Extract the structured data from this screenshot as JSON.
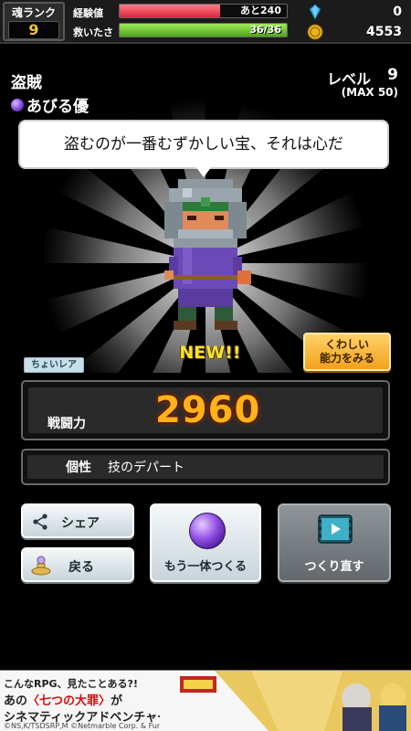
{
  "topbar": {
    "soul_rank_label": "魂ランク",
    "soul_rank_value": "9",
    "exp_label": "経験値",
    "exp_remaining": "あと240",
    "exp_fill_fraction": 0.6,
    "rescue_label": "救いたさ",
    "rescue_value": "36/36",
    "rescue_fill_fraction": 1.0,
    "gems": "0",
    "coins": "4553"
  },
  "character": {
    "class_name": "盗賊",
    "creator": "あびる優",
    "level_label": "レベル",
    "level": "9",
    "level_max": "(MAX 50)",
    "quote": "盗むのが一番むずかしい宝、それは心だ",
    "new_label": "NEW!!",
    "rarity": "ちょいレア",
    "power_label": "戦闘力",
    "power": "2960",
    "trait_label": "個性",
    "trait": "技のデパート"
  },
  "buttons": {
    "detail_line1": "くわしい",
    "detail_line2": "能力をみる",
    "share": "シェア",
    "back": "戻る",
    "make_another": "もう一体つくる",
    "remake": "つくり直す"
  },
  "banner": {
    "line1": "こんなRPG、見たことある?!",
    "line2_prefix": "あの",
    "line2_title": "〈七つの大罪〉",
    "line2_suffix": "が",
    "line3": "シネマティックアドベンチャーRPGで登場!",
    "copyright": "©NS,K/TSDSRP,M ©Netmarble Corp. & Funnypaw Co., Ltd."
  },
  "colors": {
    "exp_bar": "#e8485a",
    "rescue_bar": "#6ac92a",
    "power_text": "#ffb21a",
    "new_text": "#f7e12e"
  }
}
